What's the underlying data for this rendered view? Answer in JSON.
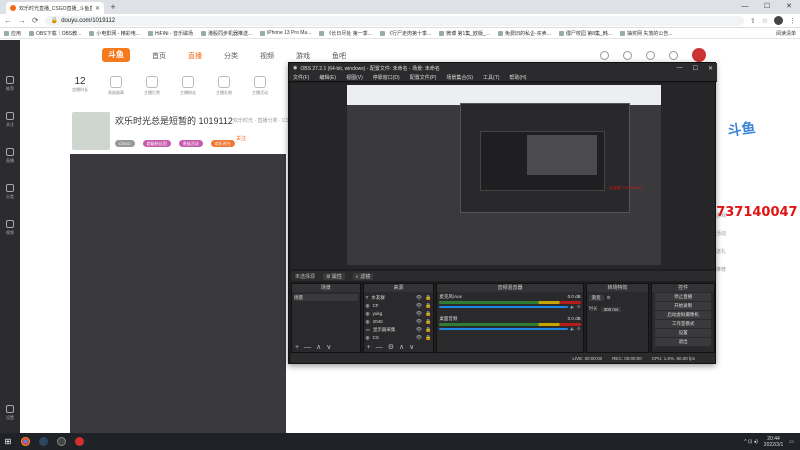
{
  "browser": {
    "tab_title": "欢乐时光直播_CSGO直播_斗鱼直播",
    "new_tab": "+",
    "window_controls": [
      "—",
      "☐",
      "✕"
    ],
    "url": "douyu.com/1019112",
    "nav": [
      "←",
      "→",
      "⟳"
    ]
  },
  "bookmarks": {
    "items": [
      "应用",
      "OBS下载｜OBS教...",
      "小电影网 - 精彩电...",
      "HiFiNi - 音乐磁场",
      "港股同步机器推送...",
      "iPhone 13 Pro Ma...",
      "《长日尽处 第一季...",
      "《行尸走肉第十季...",
      "微博 第1集_欧版_...",
      "免费旧的私企-买卖...",
      "僵尸校园 第8集_韩...",
      "抽奖网 失落的公告..."
    ],
    "reading_list": "阅读清单"
  },
  "douyu": {
    "logo": "斗鱼",
    "nav": [
      "首页",
      "直播",
      "分类",
      "视频",
      "游戏",
      "鱼吧"
    ],
    "toolbar": {
      "stat_value": "12",
      "stat_label": "会播时长",
      "items": [
        "贵族勋章",
        "主播打赏",
        "主播粉丝",
        "主播礼物",
        "主播活动",
        "关注主播"
      ]
    },
    "room_title": "欢乐时光总是短暂的 1019112",
    "room_meta": "欢乐时光 · 直播分类 · CSGO · 更多",
    "follow": "关注",
    "tags": [
      "CSGO",
      "超级粉丝团",
      "贵族活动",
      "欢乐时光"
    ],
    "side_banner": "斗鱼",
    "side_texts": [
      "游戏",
      "活动",
      "送礼",
      "推荐"
    ],
    "watermark": "水友群:737140047",
    "sidebar": [
      "推荐",
      "关注",
      "直播",
      "分类",
      "视频",
      "设置"
    ]
  },
  "obs": {
    "title": "OBS 27.2.1 (64-bit, windows) - 配置文件: 未命名 - 场景: 未命名",
    "menu": [
      "文件(F)",
      "编辑(E)",
      "视图(V)",
      "停靠窗口(D)",
      "配置文件(P)",
      "场景集合(S)",
      "工具(T)",
      "帮助(H)"
    ],
    "nested_watermark": "水友群:737140047",
    "scene_bar_label": "未选择源",
    "scene_bar_buttons": [
      "⚙ 属性",
      "◐ 滤镜"
    ],
    "docks": {
      "scenes_title": "场景",
      "scenes": [
        "场景"
      ],
      "sources_title": "来源",
      "sources": [
        {
          "icon": "T",
          "name": "水友群"
        },
        {
          "icon": "◍",
          "name": "CF"
        },
        {
          "icon": "◍",
          "name": "yukg"
        },
        {
          "icon": "◍",
          "name": "2040"
        },
        {
          "icon": "▭",
          "name": "显示器采集"
        },
        {
          "icon": "◍",
          "name": "CS"
        }
      ],
      "mixer_title": "音频混音器",
      "mixer": [
        {
          "name": "麦克风/Aux",
          "db": "0.0 dB"
        },
        {
          "name": "桌面音频",
          "db": "0.0 dB"
        }
      ],
      "transitions_title": "转场特效",
      "transition": "渐变",
      "duration_label": "时长",
      "duration": "300 ms",
      "controls_title": "控件",
      "controls": [
        "停止直播",
        "开始录制",
        "启动虚拟摄像机",
        "工作室模式",
        "设置",
        "退出"
      ],
      "footer": [
        "+",
        "—",
        "∧",
        "∨"
      ]
    },
    "status": [
      "LIVE: 00:00:00",
      "REC: 00:00:00",
      "CPU: 1.6%, 60.00 fps"
    ]
  },
  "taskbar": {
    "time": "20:44",
    "date": "2022/3/1",
    "apps": [
      "chrome-icon",
      "steam-icon",
      "obs-icon",
      "record-icon"
    ],
    "tray": "^ ⊡ ◂)"
  },
  "colors": {
    "accent": "#f56b14",
    "watermark": "#e01414",
    "obs_bg": "#1e1e20"
  }
}
